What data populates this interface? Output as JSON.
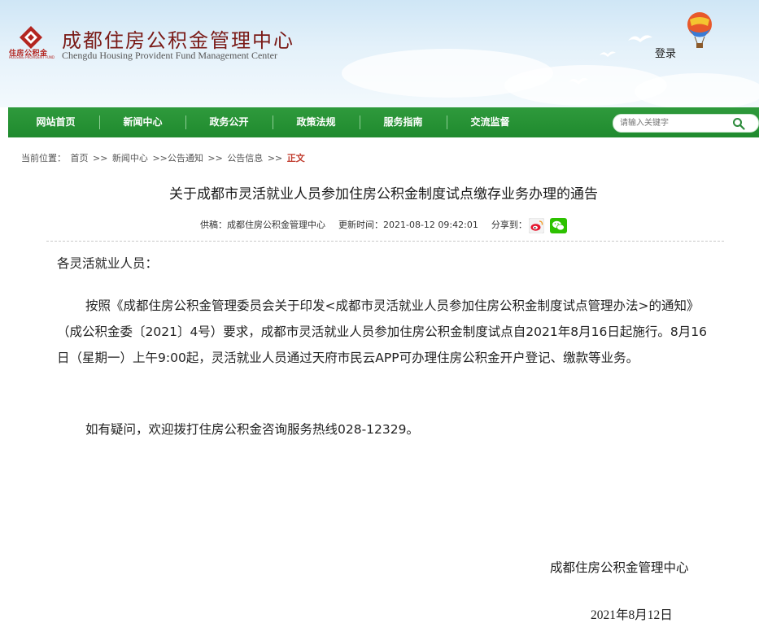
{
  "header": {
    "logo_small_text": "住房公积金",
    "logo_tiny_text": "HOUSING PROVIDENT FUND",
    "site_name_cn": "成都住房公积金管理中心",
    "site_name_en": "Chengdu Housing Provident Fund Management Center",
    "login_label": "登录"
  },
  "nav": {
    "items": [
      {
        "label": "网站首页"
      },
      {
        "label": "新闻中心"
      },
      {
        "label": "政务公开"
      },
      {
        "label": "政策法规"
      },
      {
        "label": "服务指南"
      },
      {
        "label": "交流监督"
      }
    ]
  },
  "search": {
    "placeholder": "请输入关键字"
  },
  "breadcrumb": {
    "prefix": "当前位置：",
    "items": [
      "首页",
      ">>",
      "新闻中心",
      ">>公告通知",
      ">>",
      "公告信息",
      ">>"
    ],
    "current": "正文"
  },
  "article": {
    "title": "关于成都市灵活就业人员参加住房公积金制度试点缴存业务办理的通告",
    "source": "供稿：成都住房公积金管理中心",
    "updated": "更新时间：2021-08-12 09:42:01",
    "share_label": "分享到：",
    "salutation": "各灵活就业人员：",
    "para1": "按照《成都住房公积金管理委员会关于印发<成都市灵活就业人员参加住房公积金制度试点管理办法>的通知》（成公积金委〔2021〕4号）要求，成都市灵活就业人员参加住房公积金制度试点自2021年8月16日起施行。8月16日（星期一）上午9:00起，灵活就业人员通过天府市民云APP可办理住房公积金开户登记、缴款等业务。",
    "para2": "如有疑问，欢迎拨打住房公积金咨询服务热线028-12329。",
    "signature": "成都住房公积金管理中心",
    "date": "2021年8月12日"
  },
  "icons": {
    "share_weibo": "weibo-icon",
    "share_wechat": "wechat-icon",
    "search": "search-icon",
    "balloon": "hot-air-balloon-icon",
    "logo": "housing-fund-logo-icon"
  },
  "colors": {
    "nav_green": "#1f8a2e",
    "brand_red": "#b32520",
    "breadcrumb_current": "#c0392b"
  }
}
